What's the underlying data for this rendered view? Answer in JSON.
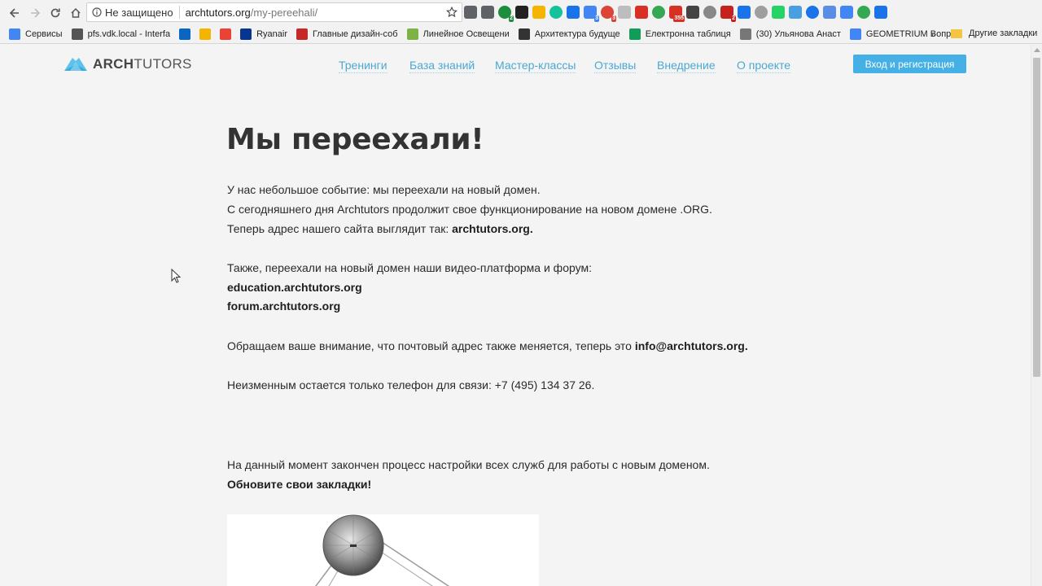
{
  "browser": {
    "security_label": "Не защищено",
    "url_domain": "archtutors.org",
    "url_path": "/my-pereehali/",
    "extension_icons": [
      {
        "name": "extension-icon-1",
        "color": "#5f6368",
        "badge": ""
      },
      {
        "name": "microphone-icon",
        "color": "#5f6368",
        "badge": ""
      },
      {
        "name": "extension-icon-green",
        "color": "#1e8e3e",
        "badge": "2"
      },
      {
        "name": "extension-icon-lt",
        "color": "#222222",
        "badge": ""
      },
      {
        "name": "extension-icon-yellow",
        "color": "#f4b400",
        "badge": ""
      },
      {
        "name": "extension-icon-grammarly",
        "color": "#15c39a",
        "badge": ""
      },
      {
        "name": "extension-icon-yoast",
        "color": "#1a73e8",
        "badge": ""
      },
      {
        "name": "extension-icon-tabs",
        "color": "#4285f4",
        "badge": "3"
      },
      {
        "name": "extension-icon-red",
        "color": "#db4437",
        "badge": "3"
      },
      {
        "name": "extension-icon-pdf",
        "color": "#bdbdbd",
        "badge": ""
      },
      {
        "name": "extension-icon-pin",
        "color": "#d93025",
        "badge": ""
      },
      {
        "name": "extension-icon-map",
        "color": "#34a853",
        "badge": ""
      },
      {
        "name": "extension-icon-gmail",
        "color": "#d93025",
        "badge": "355"
      },
      {
        "name": "extension-icon-qr",
        "color": "#444444",
        "badge": ""
      },
      {
        "name": "extension-icon-drive",
        "color": "#888888",
        "badge": ""
      },
      {
        "name": "extension-icon-abp",
        "color": "#c5221f",
        "badge": "2"
      },
      {
        "name": "extension-icon-blue",
        "color": "#1a73e8",
        "badge": ""
      },
      {
        "name": "extension-icon-gray",
        "color": "#9e9e9e",
        "badge": ""
      },
      {
        "name": "extension-icon-whatsapp",
        "color": "#25d366",
        "badge": ""
      },
      {
        "name": "extension-icon-dropbox",
        "color": "#4a9fe0",
        "badge": ""
      },
      {
        "name": "extension-icon-plus",
        "color": "#1a73e8",
        "badge": ""
      },
      {
        "name": "extension-icon-calendar",
        "color": "#5a8ee6",
        "badge": ""
      },
      {
        "name": "extension-icon-translate",
        "color": "#4285f4",
        "badge": ""
      },
      {
        "name": "extension-icon-clock",
        "color": "#34a853",
        "badge": ""
      },
      {
        "name": "extension-icon-play",
        "color": "#1a73e8",
        "badge": ""
      }
    ]
  },
  "bookmarks": {
    "items": [
      {
        "label": "Сервисы",
        "color": "#4285f4"
      },
      {
        "label": "pfs.vdk.local - Interfa",
        "color": "#555555"
      },
      {
        "label": "",
        "color": "#0a66c2"
      },
      {
        "label": "",
        "color": "#f4b400"
      },
      {
        "label": "",
        "color": "#ea4335"
      },
      {
        "label": "Ryanair",
        "color": "#073590"
      },
      {
        "label": "Главные дизайн-соб",
        "color": "#c62828"
      },
      {
        "label": "Линейное Освещени",
        "color": "#7cb342"
      },
      {
        "label": "Архитектура будуще",
        "color": "#333333"
      },
      {
        "label": "Електронна таблиця",
        "color": "#0f9d58"
      },
      {
        "label": "(30) Ульянова Анаст",
        "color": "#777777"
      },
      {
        "label": "GEOMETRIUM Вопро",
        "color": "#4285f4"
      }
    ],
    "more": "»",
    "other": "Другие закладки"
  },
  "site": {
    "logo_bold": "ARCH",
    "logo_light": "TUTORS",
    "brand_color": "#45b0e6",
    "menu": [
      "Тренинги",
      "База знаний",
      "Мастер-классы",
      "Отзывы",
      "Внедрение",
      "О проекте"
    ],
    "login_label": "Вход и регистрация"
  },
  "article": {
    "title": "Мы переехали!",
    "p1_line1": "У нас небольшое событие: мы переехали на новый домен.",
    "p1_line2": "С сегодняшнего дня Archtutors продолжит свое функционирование на новом домене .ORG.",
    "p1_line3_text": "Теперь адрес нашего сайта выглядит так: ",
    "p1_line3_bold": "archtutors.org.",
    "p2_line1": "Также, переехали на новый домен наши видео-платформа и форум:",
    "p2_link1": "education.archtutors.org",
    "p2_link2": "forum.archtutors.org",
    "p3_text": "Обращаем ваше внимание, что почтовый адрес также меняется, теперь это ",
    "p3_bold": "info@archtutors.org.",
    "p4_text": "Неизменным остается только телефон для связи: +7 (495) 134 37 26.",
    "p5_text": "На данный момент закончен процесс настройки всех служб для работы с новым доменом.",
    "p5_bold": "Обновите свои закладки!"
  }
}
